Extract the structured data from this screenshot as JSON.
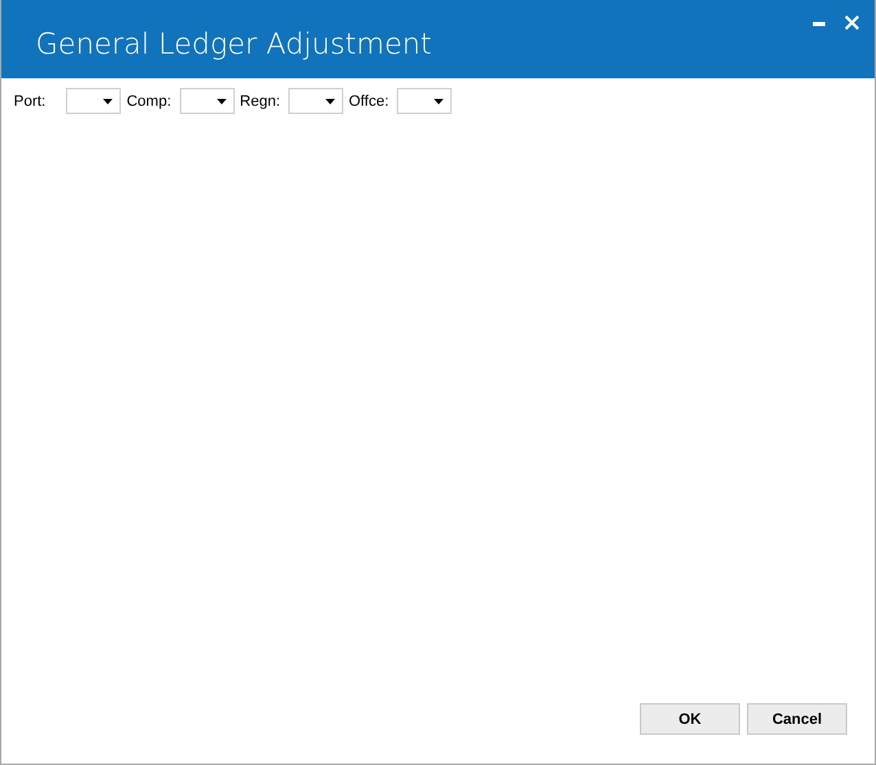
{
  "window": {
    "title": "General Ledger Adjustment"
  },
  "filters": [
    {
      "label": "Port:"
    },
    {
      "label": "Comp:"
    },
    {
      "label": "Regn:"
    },
    {
      "label": "Offce:"
    }
  ],
  "buttons": [
    "OK",
    "Cancel"
  ]
}
